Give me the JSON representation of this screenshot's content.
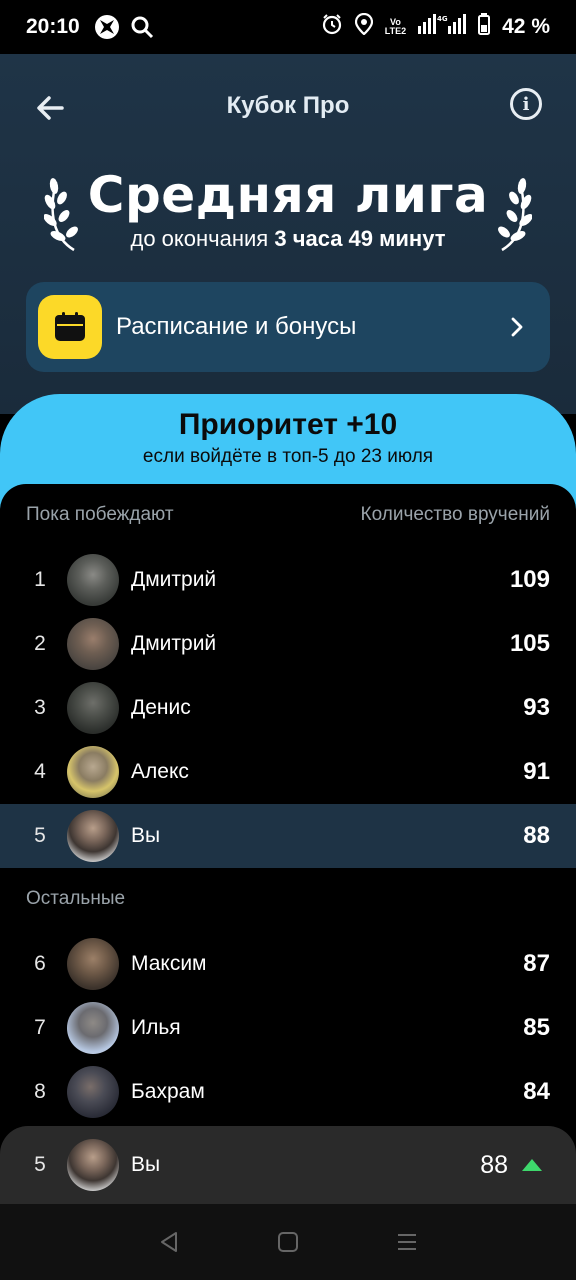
{
  "status_bar": {
    "time": "20:10",
    "volte_top": "Vo",
    "volte_bottom": "LTE2",
    "battery": "42 %"
  },
  "header": {
    "title": "Кубок Про",
    "back_icon": "arrow-left-icon",
    "info_icon": "info-icon"
  },
  "league": {
    "title": "Средняя лига",
    "ends_prefix": "до окончания",
    "ends_value": "3 часа 49 минут"
  },
  "schedule": {
    "label": "Расписание и бонусы",
    "icon": "calendar-icon",
    "icon_color": "#fcd928"
  },
  "priority": {
    "title": "Приоритет +10",
    "subtitle": "если войдёте в топ-5 до 23 июля",
    "color": "#41c6f7"
  },
  "leaders": {
    "left_header": "Пока побеждают",
    "right_header": "Количество вручений",
    "rows": [
      {
        "rank": "1",
        "name": "Дмитрий",
        "score": "109"
      },
      {
        "rank": "2",
        "name": "Дмитрий",
        "score": "105"
      },
      {
        "rank": "3",
        "name": "Денис",
        "score": "93"
      },
      {
        "rank": "4",
        "name": "Алекс",
        "score": "91"
      },
      {
        "rank": "5",
        "name": "Вы",
        "score": "88"
      }
    ]
  },
  "others": {
    "label": "Остальные",
    "rows": [
      {
        "rank": "6",
        "name": "Максим",
        "score": "87"
      },
      {
        "rank": "7",
        "name": "Илья",
        "score": "85"
      },
      {
        "rank": "8",
        "name": "Бахрам",
        "score": "84"
      }
    ]
  },
  "sticky_me": {
    "rank": "5",
    "name": "Вы",
    "score": "88",
    "trend_color": "#3ed86c"
  }
}
